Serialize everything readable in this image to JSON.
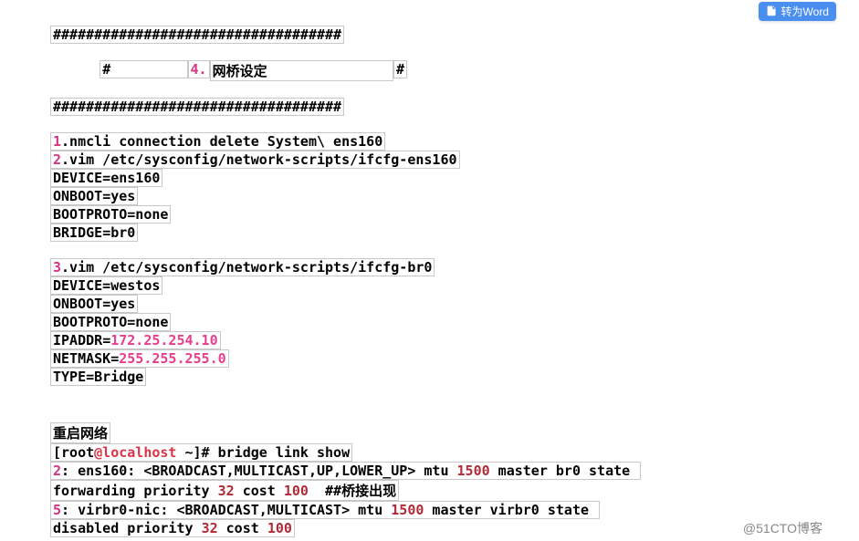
{
  "button": {
    "label": "转为Word"
  },
  "watermark": "@51CTO博客",
  "sec1": {
    "r1": "###################################",
    "r2_a": "#         ",
    "r2_b": "4.",
    "r2_c": "网桥设定               ",
    "r2_d": "#",
    "r3": "###################################"
  },
  "b1": {
    "r1_a": "1",
    "r1_b": ".nmcli connection delete System\\ ens160",
    "r2_a": "2",
    "r2_b": ".vim /etc/sysconfig/network-scripts/ifcfg-ens160",
    "r3": "DEVICE=ens160",
    "r4a": "ONBOOT",
    "r4b": "=yes",
    "r5a": "BOOTPROTO",
    "r5b": "=none",
    "r6a": "BRIDGE",
    "r6b": "=br0"
  },
  "b2": {
    "r1_a": "3",
    "r1_b": ".vim /etc/sysconfig/network-scripts/ifcfg-br0",
    "r2": "DEVICE=westos",
    "r3a": "ONBOOT",
    "r3b": "=yes",
    "r4a": "BOOTPROTO",
    "r4b": "=none",
    "r5a": "IPADDR",
    "r5b": "=",
    "r5c": "172.25.254.10",
    "r6a": "NETMASK",
    "r6b": "=",
    "r6c": "255.255.255.0",
    "r7": "TYPE=Bridge"
  },
  "b3": {
    "r1": "重启网络",
    "r2_a": "[root",
    "r2_b": "@localhost",
    "r2_c": " ~]# bridge link show",
    "r3_a": "2",
    "r3_b": ": ens160: <BROADCAST,MULTICAST,UP,LOWER_UP> mtu ",
    "r3_c": "1500",
    "r3_d": " master br0 state ",
    "r4_a": "forwarding priority ",
    "r4_b": "32",
    "r4_c": " cost ",
    "r4_d": "100",
    "r4_e": "  ##桥接出现",
    "r5_a": "5",
    "r5_b": ": virbr0-nic: <BROADCAST,MULTICAST> mtu ",
    "r5_c": "1500",
    "r5_d": " master virbr0 state ",
    "r6_a": "disabled priority ",
    "r6_b": "32",
    "r6_c": " cost ",
    "r6_d": "100"
  }
}
